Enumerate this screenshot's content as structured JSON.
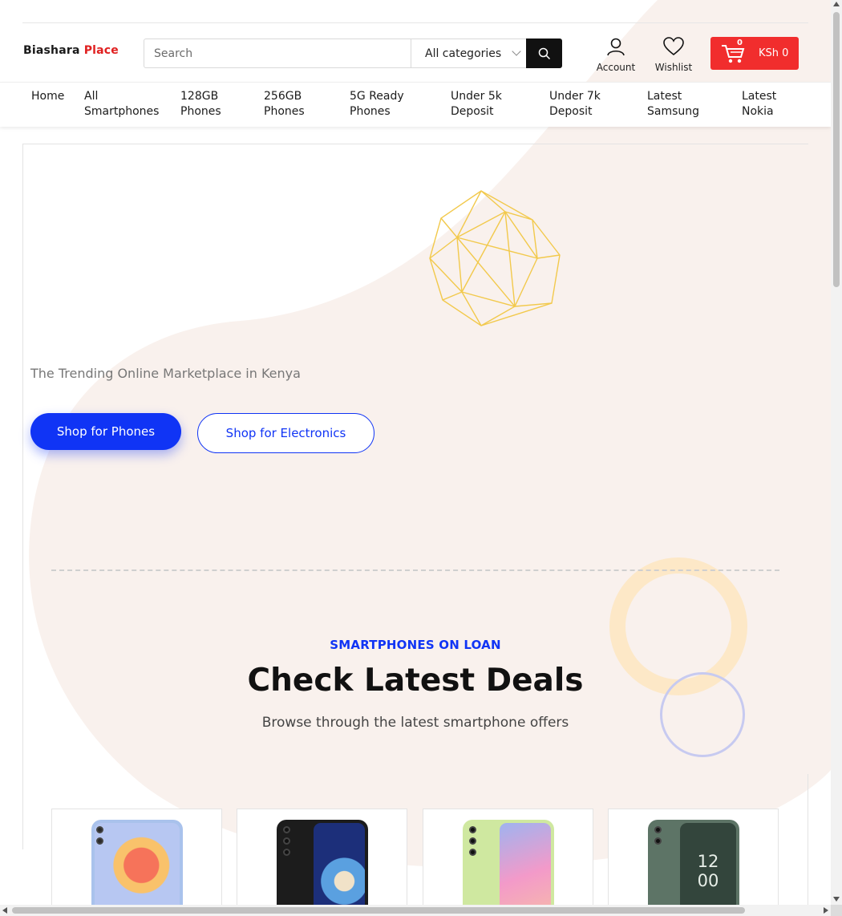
{
  "header": {
    "logo_part1": "Biashara",
    "logo_part2": "Place",
    "search_placeholder": "Search",
    "category_select": "All categories",
    "account_label": "Account",
    "wishlist_label": "Wishlist",
    "cart_count": "0",
    "cart_amount": "KSh 0"
  },
  "nav": {
    "items": [
      {
        "label_line1": "Home",
        "label_line2": ""
      },
      {
        "label_line1": "All",
        "label_line2": "Smartphones"
      },
      {
        "label_line1": "128GB",
        "label_line2": "Phones"
      },
      {
        "label_line1": "256GB",
        "label_line2": "Phones"
      },
      {
        "label_line1": "5G Ready",
        "label_line2": "Phones"
      },
      {
        "label_line1": "Under 5k",
        "label_line2": "Deposit"
      },
      {
        "label_line1": "Under 7k",
        "label_line2": "Deposit"
      },
      {
        "label_line1": "Latest",
        "label_line2": "Samsung"
      },
      {
        "label_line1": "Latest",
        "label_line2": "Nokia"
      }
    ]
  },
  "hero": {
    "tagline": "The Trending Online Marketplace in Kenya",
    "primary_button": "Shop for Phones",
    "secondary_button": "Shop for Electronics"
  },
  "deals": {
    "eyebrow": "SMARTPHONES ON LOAN",
    "title": "Check Latest Deals",
    "subtitle": "Browse through the latest smartphone offers"
  },
  "products": [
    {
      "name": "phone-blue",
      "body_color": "#a9c2ec",
      "screen_color": "#f2a07c"
    },
    {
      "name": "phone-black",
      "body_color": "#1c1c1c",
      "screen_color": "#3a67b8"
    },
    {
      "name": "phone-lime",
      "body_color": "#cfe8a0",
      "screen_color": "#e79ac1"
    },
    {
      "name": "phone-green",
      "body_color": "#5d7466",
      "screen_color": "#33453c",
      "screen_text_top": "12",
      "screen_text_bottom": "00"
    }
  ],
  "colors": {
    "accent_blue": "#1034f5",
    "cart_red": "#f12d2d",
    "logo_red": "#e02020",
    "blob_beige": "#f9f1ed",
    "polyhedron_gold": "#f2c94c"
  }
}
